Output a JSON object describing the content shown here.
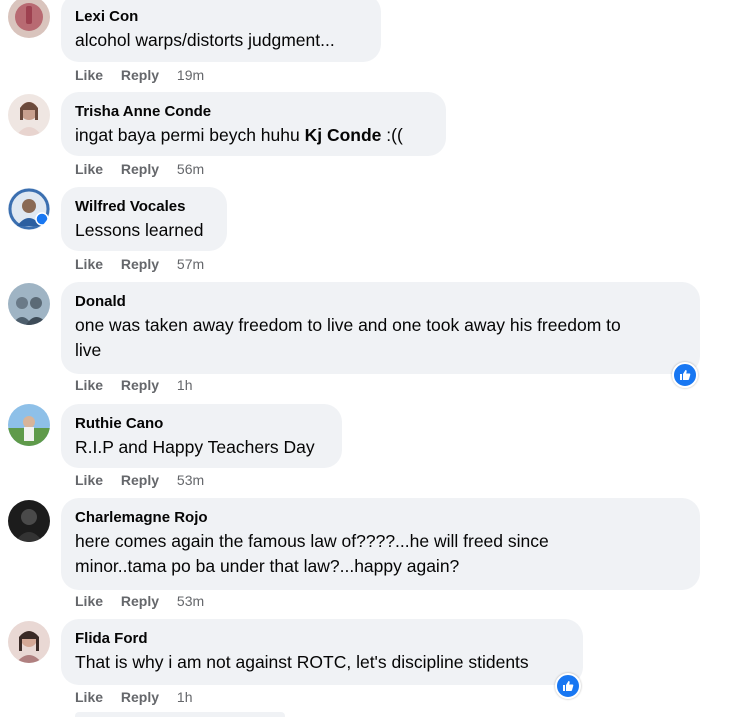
{
  "comments": [
    {
      "name": "Lexi Con",
      "text": "alcohol warps/distorts judgment...",
      "like": "Like",
      "reply": "Reply",
      "time": "19m"
    },
    {
      "name": "Trisha Anne Conde",
      "text": "ingat baya permi beych huhu ",
      "mention": "Kj Conde",
      "text_after": " :((",
      "like": "Like",
      "reply": "Reply",
      "time": "56m"
    },
    {
      "name": "Wilfred Vocales",
      "text": "Lessons learned",
      "like": "Like",
      "reply": "Reply",
      "time": "57m"
    },
    {
      "name": "Donald",
      "text_line1": "one was taken away freedom to live and one took away his freedom to",
      "text_line2": "live",
      "like": "Like",
      "reply": "Reply",
      "time": "1h"
    },
    {
      "name": "Ruthie Cano",
      "text": "R.I.P and Happy Teachers Day",
      "like": "Like",
      "reply": "Reply",
      "time": "53m"
    },
    {
      "name": "Charlemagne Rojo",
      "text_line1": "here comes again the famous law of????...he will freed since",
      "text_line2": "minor..tama po ba under that law?...happy again?",
      "like": "Like",
      "reply": "Reply",
      "time": "53m"
    },
    {
      "name": "Flida Ford",
      "text": "That is why i am not against ROTC, let's discipline stidents",
      "like": "Like",
      "reply": "Reply",
      "time": "1h"
    }
  ],
  "colors": {
    "bubble": "#f0f2f5",
    "meta": "#65676b",
    "reaction": "#1877f2"
  },
  "icons": {
    "reaction": "thumbs-up-icon"
  }
}
